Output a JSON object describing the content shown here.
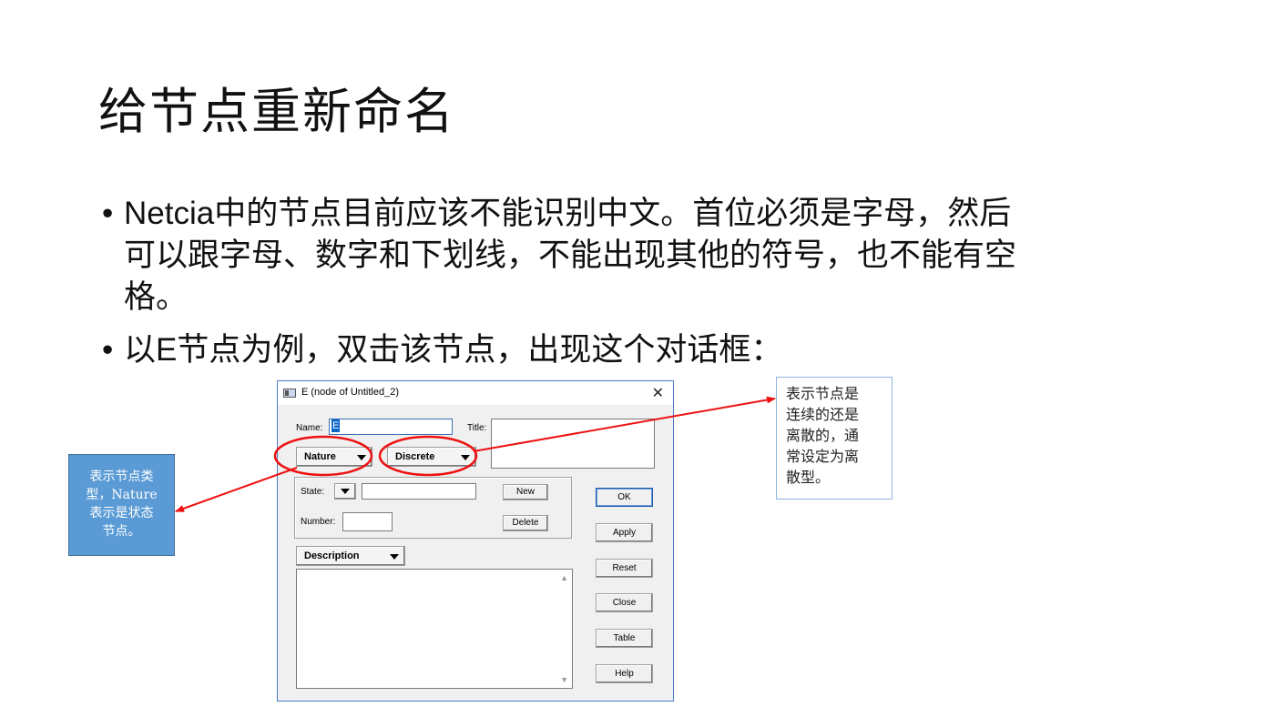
{
  "slide": {
    "title": "给节点重新命名",
    "bullets": [
      {
        "line1_latin": "Netcia",
        "line1_rest": "中的节点目前应该不能识别中文。首位必须是字母，然后",
        "line2": "可以跟字母、数字和下划线，不能出现其他的符号，也不能有空",
        "line3": "格。"
      },
      {
        "pre": "以",
        "latin": "E",
        "post": "节点为例，双击该节点，出现这个对话框："
      }
    ]
  },
  "dialog": {
    "title": "E (node of Untitled_2)",
    "close_glyph": "✕",
    "name_label": "Name:",
    "name_value": "E",
    "title_label": "Title:",
    "title_value": "",
    "nature_label": "Nature",
    "discrete_label": "Discrete",
    "state_label": "State:",
    "state_value": "",
    "number_label": "Number:",
    "number_value": "",
    "new_button": "New",
    "delete_button": "Delete",
    "description_label": "Description",
    "description_value": "",
    "side_buttons": {
      "ok": "OK",
      "apply": "Apply",
      "reset": "Reset",
      "close": "Close",
      "table": "Table",
      "help": "Help"
    }
  },
  "callouts": {
    "left": {
      "line1": "表示节点类",
      "line2": "型，Nature",
      "line3": "表示是状态",
      "line4": "节点。"
    },
    "right": {
      "line1": "表示节点是",
      "line2": "连续的还是",
      "line3": "离散的，通",
      "line4": "常设定为离",
      "line5": "散型。"
    }
  },
  "colors": {
    "annotation": "#ee1111",
    "callout_fill": "#5b9bd5",
    "dialog_border": "#4a7bc4"
  },
  "icons": {
    "dropdown": "triangle-down-icon",
    "close": "close-icon",
    "scroll": "scroll-arrow-icon"
  }
}
